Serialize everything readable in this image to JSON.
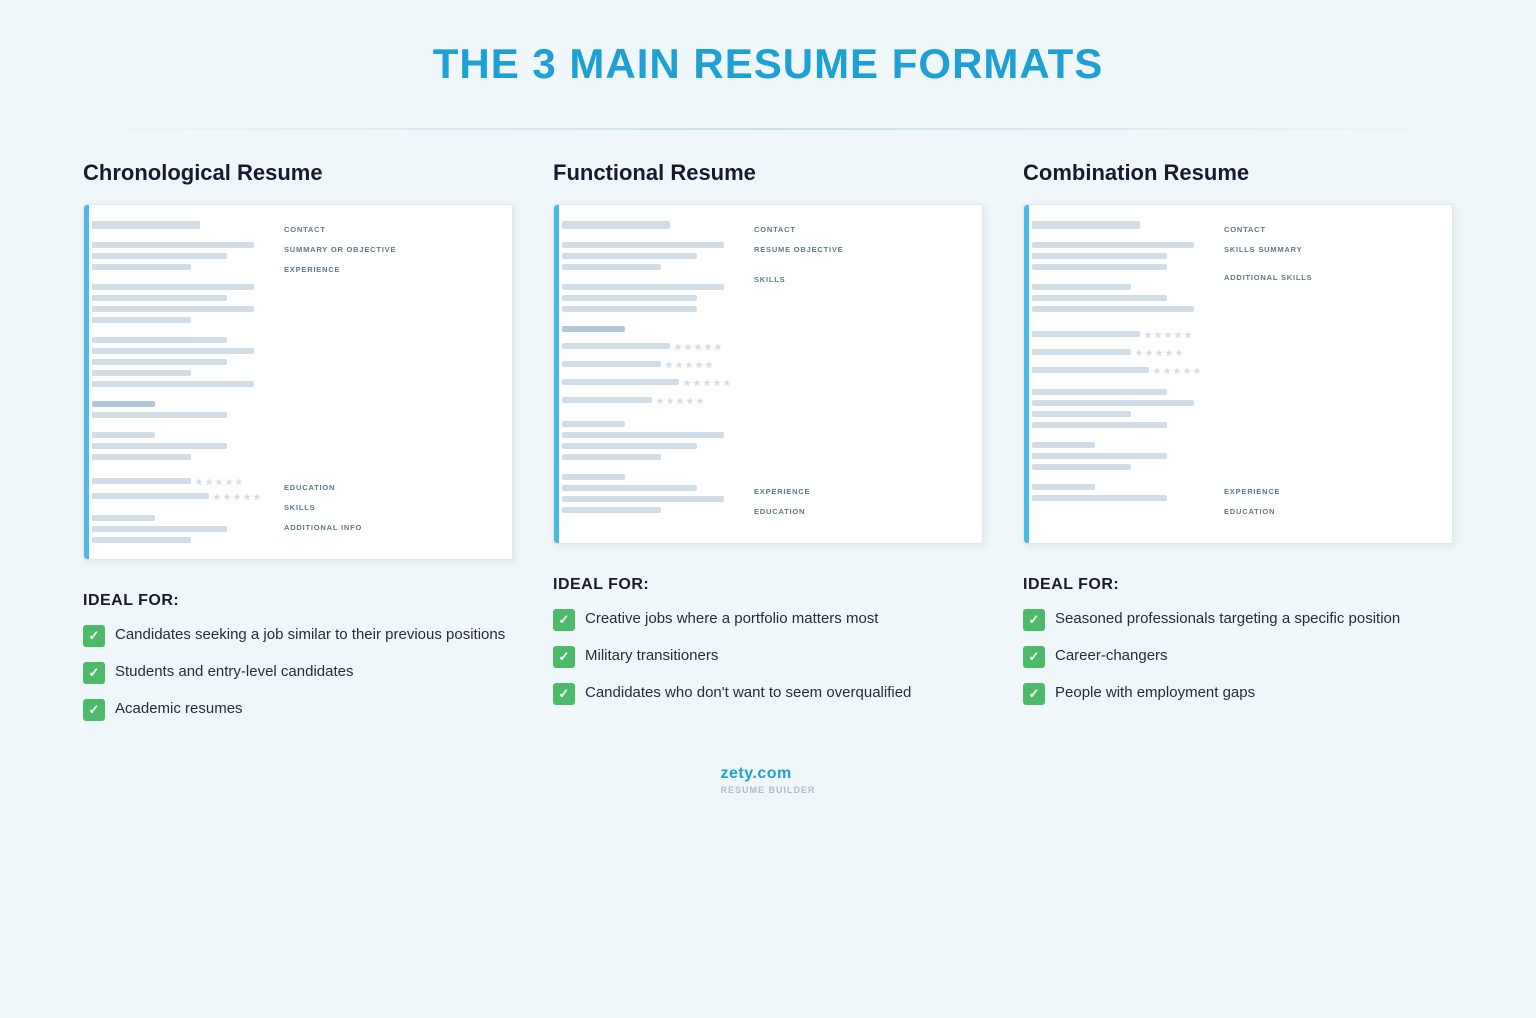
{
  "page": {
    "title": "THE 3 MAIN RESUME FORMATS",
    "footer": "zety.com",
    "footer_sub": "RESUME BUILDER"
  },
  "columns": [
    {
      "id": "chronological",
      "title": "Chronological Resume",
      "resume_sections": [
        "CONTACT",
        "SUMMARY OR OBJECTIVE",
        "EXPERIENCE",
        "EDUCATION",
        "SKILLS",
        "ADDITIONAL INFO"
      ],
      "ideal_title": "IDEAL FOR:",
      "ideal_items": [
        "Candidates seeking a job similar to their previous positions",
        "Students and entry-level candidates",
        "Academic resumes"
      ]
    },
    {
      "id": "functional",
      "title": "Functional Resume",
      "resume_sections": [
        "CONTACT",
        "RESUME OBJECTIVE",
        "SKILLS",
        "EXPERIENCE",
        "EDUCATION"
      ],
      "ideal_title": "IDEAL FOR:",
      "ideal_items": [
        "Creative jobs where a portfolio matters most",
        "Military transitioners",
        "Candidates who don't want to seem overqualified"
      ]
    },
    {
      "id": "combination",
      "title": "Combination Resume",
      "resume_sections": [
        "CONTACT",
        "SKILLS SUMMARY",
        "ADDITIONAL SKILLS",
        "EXPERIENCE",
        "EDUCATION"
      ],
      "ideal_title": "IDEAL FOR:",
      "ideal_items": [
        "Seasoned professionals targeting a specific position",
        "Career-changers",
        "People with employment gaps"
      ]
    }
  ]
}
